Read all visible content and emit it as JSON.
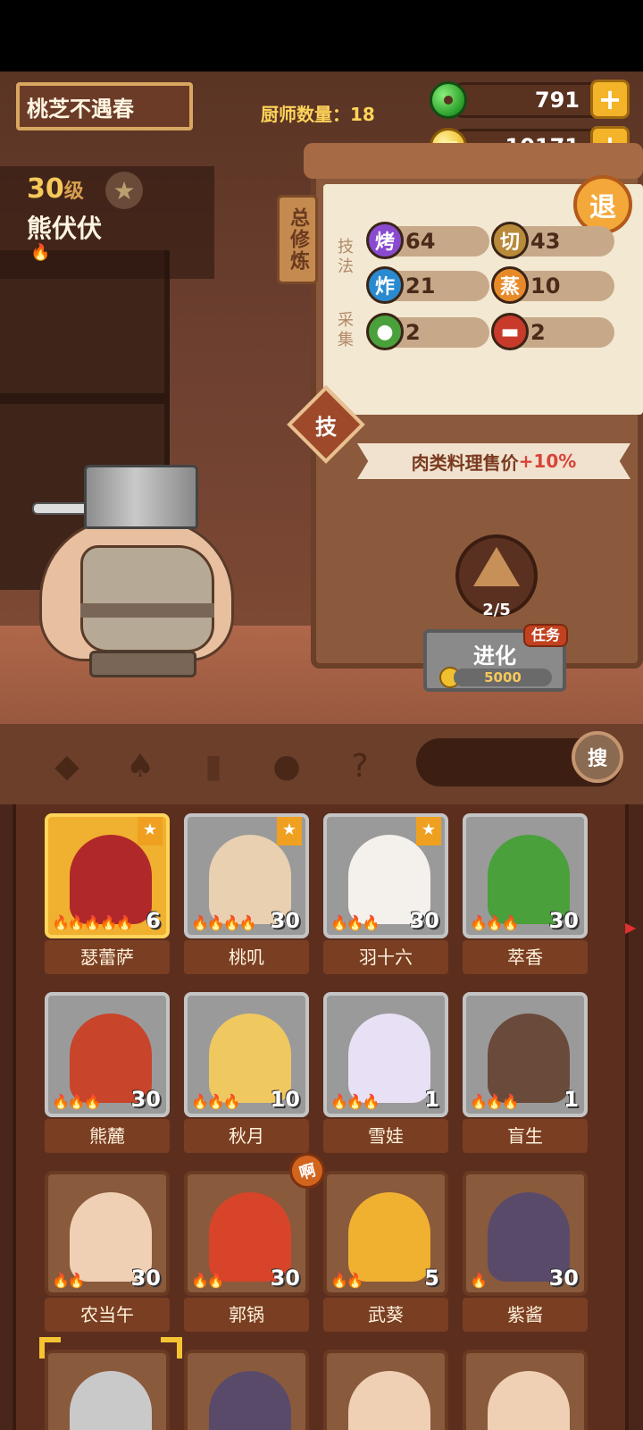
{
  "player": {
    "name": "桃芝不遇春"
  },
  "chef_count": {
    "label": "厨师数量：",
    "value": "18"
  },
  "currency": {
    "jade": {
      "icon": "jade-icon",
      "value": "791",
      "plus": "+"
    },
    "gold": {
      "icon": "coin-icon",
      "value": "10171",
      "plus": "+"
    }
  },
  "selected_chef": {
    "level": "30",
    "level_unit": "级",
    "name": "熊伏伏"
  },
  "cultivation_tag": "总修炼",
  "retreat_button": "退",
  "skills": {
    "technique_label": "技法",
    "gather_label": "采集",
    "items": [
      {
        "icon": "烤",
        "value": "64",
        "color": "#8a4ad0"
      },
      {
        "icon": "切",
        "value": "43",
        "color": "#b88a3a"
      },
      {
        "icon": "炸",
        "value": "21",
        "color": "#2a8ad0"
      },
      {
        "icon": "蒸",
        "value": "10",
        "color": "#e88a2a"
      },
      {
        "icon": "vegetable-icon",
        "value": "2",
        "color": "#4aa03a"
      },
      {
        "icon": "meat-icon",
        "value": "2",
        "color": "#c83a2a"
      }
    ]
  },
  "tech_button": "技",
  "bonus_ribbon": {
    "text": "肉类料理售价",
    "pct": "+10%"
  },
  "evolution": {
    "progress": "2/5",
    "button_label": "进化",
    "cost": "5000",
    "task_tag": "任务"
  },
  "toolbar": {
    "tools": [
      "meat-filter-icon",
      "shovel-icon",
      "jar-icon",
      "location-icon",
      "map-quest-icon"
    ],
    "search_label": "搜"
  },
  "badge_ah": "啊",
  "chefs": [
    {
      "name": "瑟蕾萨",
      "level": "6",
      "flames": 5,
      "star": true,
      "frame": "gold",
      "art": "#b0282a"
    },
    {
      "name": "桃叽",
      "level": "30",
      "flames": 4,
      "star": true,
      "frame": "gray",
      "art": "#e8d0b0"
    },
    {
      "name": "羽十六",
      "level": "30",
      "flames": 3,
      "star": true,
      "frame": "gray",
      "art": "#f4f0ec"
    },
    {
      "name": "萃香",
      "level": "30",
      "flames": 3,
      "star": false,
      "frame": "gray",
      "art": "#4aa03a"
    },
    {
      "name": "熊麓",
      "level": "30",
      "flames": 3,
      "star": false,
      "frame": "gray",
      "art": "#c8442a"
    },
    {
      "name": "秋月",
      "level": "10",
      "flames": 3,
      "star": false,
      "frame": "gray",
      "art": "#f0c860"
    },
    {
      "name": "雪娃",
      "level": "1",
      "flames": 3,
      "star": false,
      "frame": "gray",
      "art": "#e8e0f4"
    },
    {
      "name": "盲生",
      "level": "1",
      "flames": 3,
      "star": false,
      "frame": "gray",
      "art": "#6a4a3a"
    },
    {
      "name": "农当午",
      "level": "30",
      "flames": 2,
      "star": false,
      "frame": "brown",
      "art": "#f0d0b4"
    },
    {
      "name": "郭锅",
      "level": "30",
      "flames": 2,
      "star": false,
      "frame": "brown",
      "art": "#d8442a"
    },
    {
      "name": "武葵",
      "level": "5",
      "flames": 2,
      "star": false,
      "frame": "brown",
      "art": "#f0b030"
    },
    {
      "name": "紫酱",
      "level": "30",
      "flames": 1,
      "star": false,
      "frame": "brown",
      "art": "#5a4a6a"
    }
  ]
}
